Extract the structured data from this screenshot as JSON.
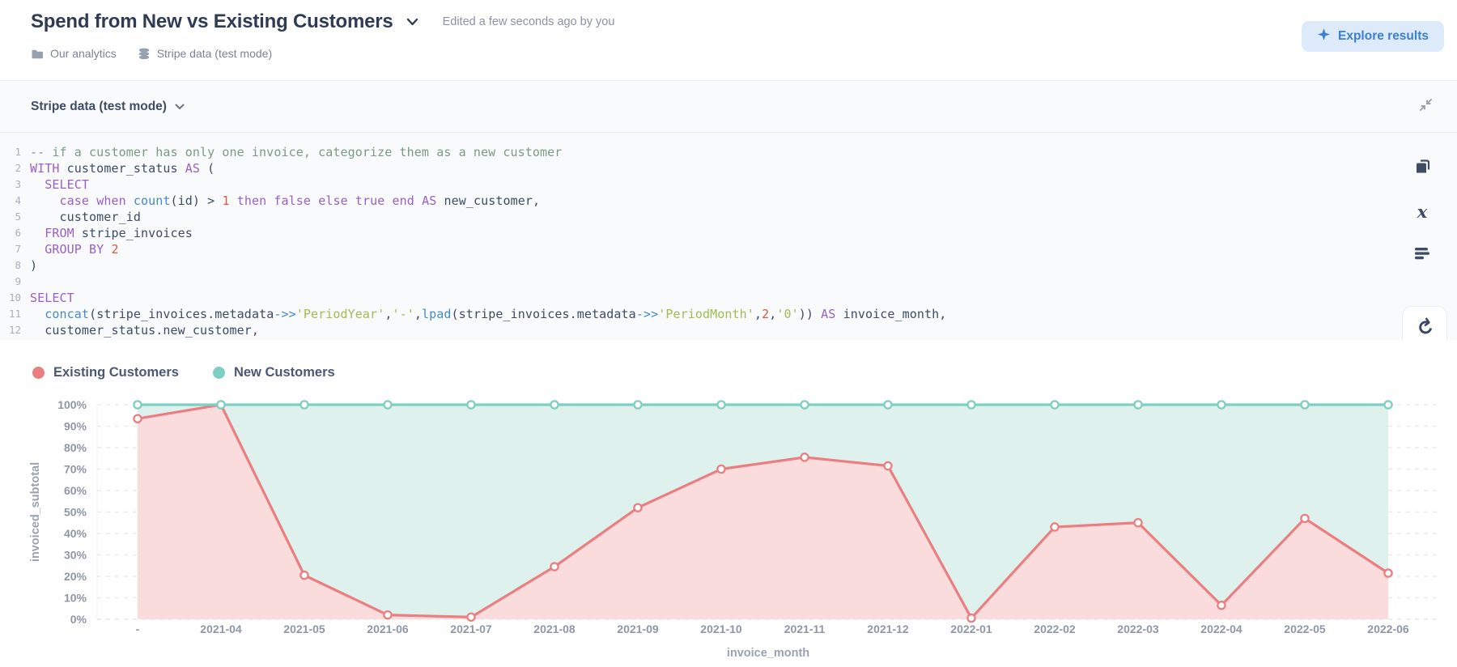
{
  "header": {
    "title": "Spend from New vs Existing Customers",
    "edited_note": "Edited a few seconds ago by you",
    "explore_button": "Explore results",
    "breadcrumbs": [
      {
        "icon": "folder-icon",
        "label": "Our analytics"
      },
      {
        "icon": "database-icon",
        "label": "Stripe data (test mode)"
      }
    ]
  },
  "editor": {
    "datasource": "Stripe data (test mode)",
    "sql_lines": [
      {
        "num": "1",
        "tokens": [
          [
            "c",
            "-- if a customer has only one invoice, categorize them as a new customer"
          ]
        ]
      },
      {
        "num": "2",
        "tokens": [
          [
            "k",
            "WITH"
          ],
          [
            "p",
            " customer_status "
          ],
          [
            "k",
            "AS"
          ],
          [
            "p",
            " ("
          ]
        ]
      },
      {
        "num": "3",
        "tokens": [
          [
            "p",
            "  "
          ],
          [
            "k",
            "SELECT"
          ]
        ]
      },
      {
        "num": "4",
        "tokens": [
          [
            "p",
            "    "
          ],
          [
            "k",
            "case"
          ],
          [
            "p",
            " "
          ],
          [
            "k",
            "when"
          ],
          [
            "p",
            " "
          ],
          [
            "f",
            "count"
          ],
          [
            "p",
            "(id) > "
          ],
          [
            "n",
            "1"
          ],
          [
            "p",
            " "
          ],
          [
            "k",
            "then"
          ],
          [
            "p",
            " "
          ],
          [
            "k",
            "false"
          ],
          [
            "p",
            " "
          ],
          [
            "k",
            "else"
          ],
          [
            "p",
            " "
          ],
          [
            "k",
            "true"
          ],
          [
            "p",
            " "
          ],
          [
            "k",
            "end"
          ],
          [
            "p",
            " "
          ],
          [
            "k",
            "AS"
          ],
          [
            "p",
            " new_customer,"
          ]
        ]
      },
      {
        "num": "5",
        "tokens": [
          [
            "p",
            "    customer_id"
          ]
        ]
      },
      {
        "num": "6",
        "tokens": [
          [
            "p",
            "  "
          ],
          [
            "k",
            "FROM"
          ],
          [
            "p",
            " stripe_invoices"
          ]
        ]
      },
      {
        "num": "7",
        "tokens": [
          [
            "p",
            "  "
          ],
          [
            "k",
            "GROUP BY"
          ],
          [
            "p",
            " "
          ],
          [
            "n",
            "2"
          ]
        ]
      },
      {
        "num": "8",
        "tokens": [
          [
            "p",
            ")"
          ]
        ]
      },
      {
        "num": "9",
        "tokens": []
      },
      {
        "num": "10",
        "tokens": [
          [
            "k",
            "SELECT"
          ]
        ]
      },
      {
        "num": "11",
        "tokens": [
          [
            "p",
            "  "
          ],
          [
            "f",
            "concat"
          ],
          [
            "p",
            "(stripe_invoices.metadata"
          ],
          [
            "f",
            "->>"
          ],
          [
            "s",
            "'PeriodYear'"
          ],
          [
            "p",
            ","
          ],
          [
            "s",
            "'-'"
          ],
          [
            "p",
            ","
          ],
          [
            "f",
            "lpad"
          ],
          [
            "p",
            "(stripe_invoices.metadata"
          ],
          [
            "f",
            "->>"
          ],
          [
            "s",
            "'PeriodMonth'"
          ],
          [
            "p",
            ","
          ],
          [
            "n",
            "2"
          ],
          [
            "p",
            ","
          ],
          [
            "s",
            "'0'"
          ],
          [
            "p",
            ")) "
          ],
          [
            "k",
            "AS"
          ],
          [
            "p",
            " invoice_month,"
          ]
        ]
      },
      {
        "num": "12",
        "tokens": [
          [
            "p",
            "  customer_status.new_customer,"
          ]
        ]
      }
    ]
  },
  "chart_data": {
    "type": "area",
    "title": "",
    "categories": [
      "-",
      "2021-04",
      "2021-05",
      "2021-06",
      "2021-07",
      "2021-08",
      "2021-09",
      "2021-10",
      "2021-11",
      "2021-12",
      "2022-01",
      "2022-02",
      "2022-03",
      "2022-04",
      "2022-05",
      "2022-06"
    ],
    "series": [
      {
        "name": "Existing Customers",
        "color": "#EB7E81",
        "fill": "#FBDCDC",
        "values": [
          93.5,
          100,
          20.5,
          2,
          1,
          24.5,
          52,
          70,
          75.5,
          71.5,
          0.5,
          43,
          45,
          6.5,
          47,
          21.5
        ]
      },
      {
        "name": "New Customers",
        "color": "#7DCFC4",
        "fill": "#DFF1ED",
        "values": [
          100,
          100,
          100,
          100,
          100,
          100,
          100,
          100,
          100,
          100,
          100,
          100,
          100,
          100,
          100,
          100
        ]
      }
    ],
    "xlabel": "invoice_month",
    "ylabel": "invoiced_subtotal",
    "ylim": [
      0,
      100
    ],
    "yticks": [
      "0%",
      "10%",
      "20%",
      "30%",
      "40%",
      "50%",
      "60%",
      "70%",
      "80%",
      "90%",
      "100%"
    ],
    "grid": "dashed-horizontal",
    "legend_position": "top-left",
    "axis_text_color": "#8F96A6"
  }
}
